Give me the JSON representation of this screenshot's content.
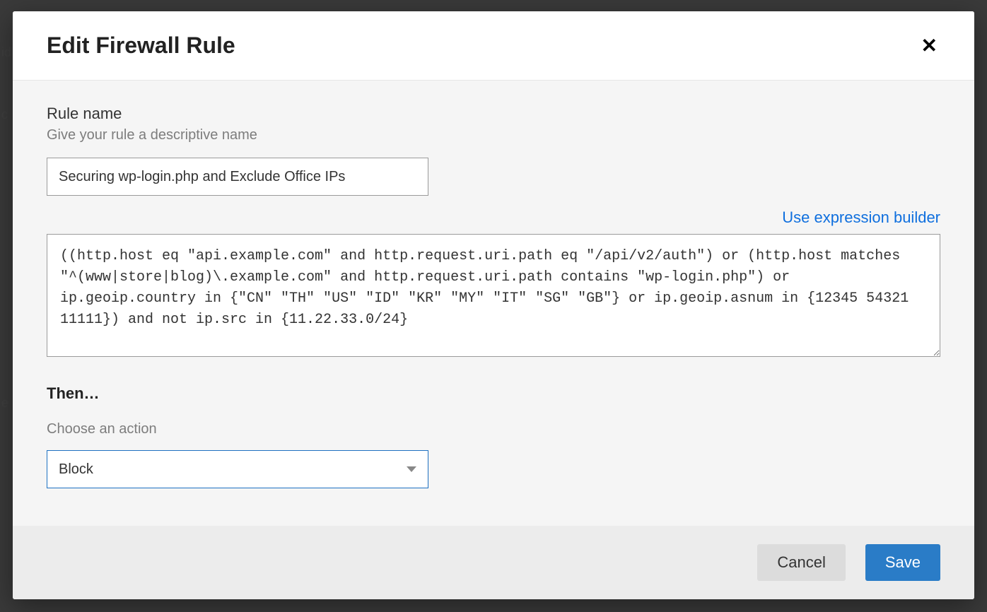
{
  "modal": {
    "title": "Edit Firewall Rule",
    "close_icon": "✕"
  },
  "rule_name": {
    "label": "Rule name",
    "hint": "Give your rule a descriptive name",
    "value": "Securing wp-login.php and Exclude Office IPs"
  },
  "builder_link": "Use expression builder",
  "expression": "((http.host eq \"api.example.com\" and http.request.uri.path eq \"/api/v2/auth\") or (http.host matches \"^(www|store|blog)\\.example.com\" and http.request.uri.path contains \"wp-login.php\") or ip.geoip.country in {\"CN\" \"TH\" \"US\" \"ID\" \"KR\" \"MY\" \"IT\" \"SG\" \"GB\"} or ip.geoip.asnum in {12345 54321 11111}) and not ip.src in {11.22.33.0/24}",
  "then": {
    "heading": "Then…",
    "action_label": "Choose an action",
    "action_value": "Block"
  },
  "footer": {
    "cancel": "Cancel",
    "save": "Save"
  }
}
